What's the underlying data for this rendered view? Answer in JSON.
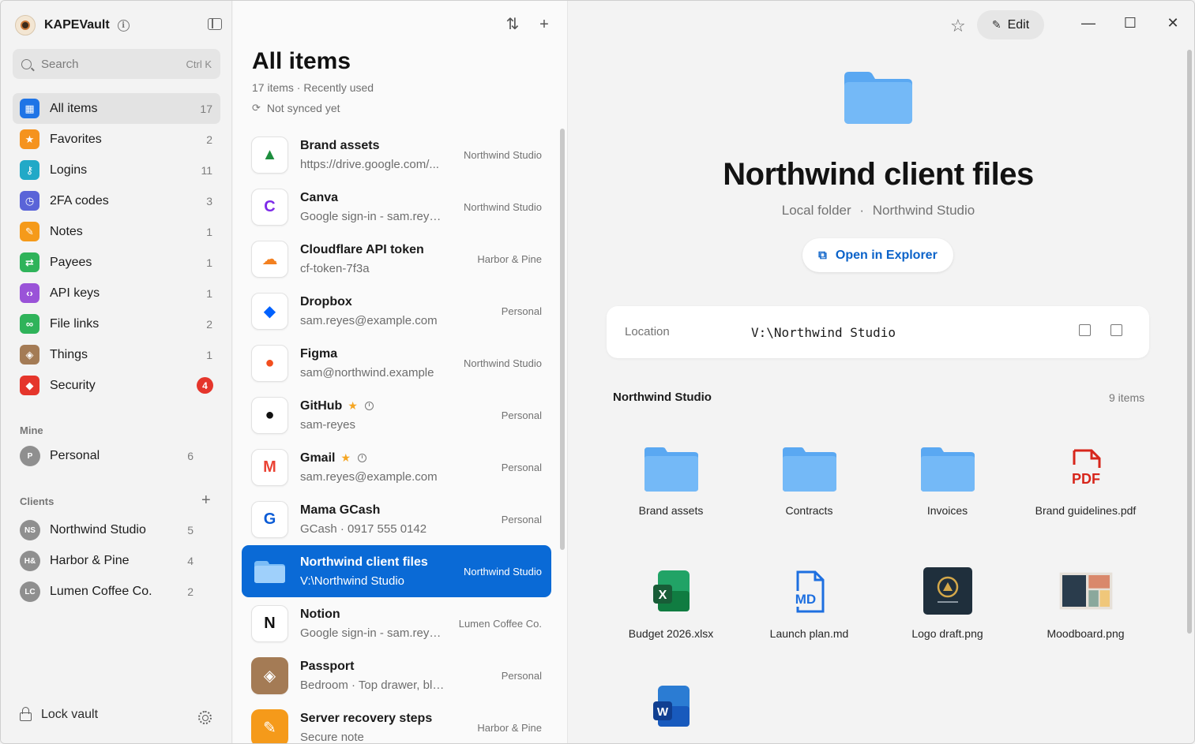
{
  "app": {
    "name": "KAPEVault"
  },
  "search": {
    "placeholder": "Search",
    "shortcut": "Ctrl K"
  },
  "nav": [
    {
      "label": "All items",
      "count": "17",
      "color": "#1f74e6",
      "glyph": "▦"
    },
    {
      "label": "Favorites",
      "count": "2",
      "color": "#f5931e",
      "glyph": "★"
    },
    {
      "label": "Logins",
      "count": "11",
      "color": "#22a9c7",
      "glyph": "⚷"
    },
    {
      "label": "2FA codes",
      "count": "3",
      "color": "#5a64d8",
      "glyph": "◷"
    },
    {
      "label": "Notes",
      "count": "1",
      "color": "#f59a1a",
      "glyph": "✎"
    },
    {
      "label": "Payees",
      "count": "1",
      "color": "#2fb35a",
      "glyph": "⇄"
    },
    {
      "label": "API keys",
      "count": "1",
      "color": "#9a53d8",
      "glyph": "‹›"
    },
    {
      "label": "File links",
      "count": "2",
      "color": "#2fb35a",
      "glyph": "∞"
    },
    {
      "label": "Things",
      "count": "1",
      "color": "#a47b55",
      "glyph": "◈"
    },
    {
      "label": "Security",
      "count": "4",
      "color": "#e5352b",
      "glyph": "◆"
    }
  ],
  "sections": {
    "mine": "Mine",
    "clients": "Clients"
  },
  "vaults_mine": [
    {
      "initials": "P",
      "label": "Personal",
      "count": "6"
    }
  ],
  "vaults_clients": [
    {
      "initials": "NS",
      "label": "Northwind Studio",
      "count": "5"
    },
    {
      "initials": "H&",
      "label": "Harbor & Pine",
      "count": "4"
    },
    {
      "initials": "LC",
      "label": "Lumen Coffee Co.",
      "count": "2"
    }
  ],
  "footer": {
    "lock_label": "Lock vault"
  },
  "list": {
    "title": "All items",
    "subtitle": "17 items · Recently used",
    "sync": "Not synced yet",
    "items": [
      {
        "title": "Brand assets",
        "sub": "https://drive.google.com/...",
        "vault": "Northwind Studio",
        "icon": "google-drive-icon",
        "glyph": "▲",
        "color": "#1e8e3e"
      },
      {
        "title": "Canva",
        "sub": "Google sign-in - sam.reyes@...",
        "vault": "Northwind Studio",
        "icon": "canva-icon",
        "glyph": "C",
        "color": "#7d2ae8"
      },
      {
        "title": "Cloudflare API token",
        "sub": "cf-token-7f3a",
        "vault": "Harbor & Pine",
        "icon": "cloudflare-icon",
        "glyph": "☁",
        "color": "#f38020"
      },
      {
        "title": "Dropbox",
        "sub": "sam.reyes@example.com",
        "vault": "Personal",
        "icon": "dropbox-icon",
        "glyph": "◆",
        "color": "#0061fe"
      },
      {
        "title": "Figma",
        "sub": "sam@northwind.example",
        "vault": "Northwind Studio",
        "icon": "figma-icon",
        "glyph": "●",
        "color": "#f24e1e"
      },
      {
        "title": "GitHub",
        "sub": "sam-reyes",
        "vault": "Personal",
        "icon": "github-icon",
        "glyph": "●",
        "color": "#111111",
        "favorite": true,
        "recent": true
      },
      {
        "title": "Gmail",
        "sub": "sam.reyes@example.com",
        "vault": "Personal",
        "icon": "gmail-icon",
        "glyph": "M",
        "color": "#ea4335",
        "favorite": true,
        "recent": true
      },
      {
        "title": "Mama GCash",
        "sub": "GCash · 0917 555 0142",
        "vault": "Personal",
        "icon": "gcash-icon",
        "glyph": "G",
        "color": "#0a5bd6"
      },
      {
        "title": "Northwind client files",
        "sub": "V:\\Northwind Studio",
        "vault": "Northwind Studio",
        "icon": "folder-icon",
        "glyph": "",
        "color": "#6cb3f5",
        "selected": true
      },
      {
        "title": "Notion",
        "sub": "Google sign-in - sam.reyes@...",
        "vault": "Lumen Coffee Co.",
        "icon": "notion-icon",
        "glyph": "N",
        "color": "#111111"
      },
      {
        "title": "Passport",
        "sub": "Bedroom · Top drawer, blue folder",
        "vault": "Personal",
        "icon": "box-icon",
        "glyph": "◈",
        "color": "#a47b55"
      },
      {
        "title": "Server recovery steps",
        "sub": "Secure note",
        "vault": "Harbor & Pine",
        "icon": "note-icon",
        "glyph": "✎",
        "color": "#f59a1a"
      }
    ]
  },
  "detail": {
    "edit_label": "Edit",
    "title": "Northwind client files",
    "type": "Local folder",
    "vault": "Northwind Studio",
    "open_label": "Open in Explorer",
    "location_label": "Location",
    "location_value": "V:\\Northwind Studio",
    "grid_title": "Northwind Studio",
    "grid_count": "9 items",
    "files": [
      {
        "name": "Brand assets",
        "kind": "folder"
      },
      {
        "name": "Contracts",
        "kind": "folder"
      },
      {
        "name": "Invoices",
        "kind": "folder"
      },
      {
        "name": "Brand guidelines.pdf",
        "kind": "pdf"
      },
      {
        "name": "Budget 2026.xlsx",
        "kind": "xlsx"
      },
      {
        "name": "Launch plan.md",
        "kind": "md"
      },
      {
        "name": "Logo draft.png",
        "kind": "logo"
      },
      {
        "name": "Moodboard.png",
        "kind": "mood"
      },
      {
        "name": "",
        "kind": "docx"
      }
    ]
  },
  "colors": {
    "accent": "#0a6ad6",
    "link": "#0a62c9",
    "badge": "#e5352b"
  }
}
